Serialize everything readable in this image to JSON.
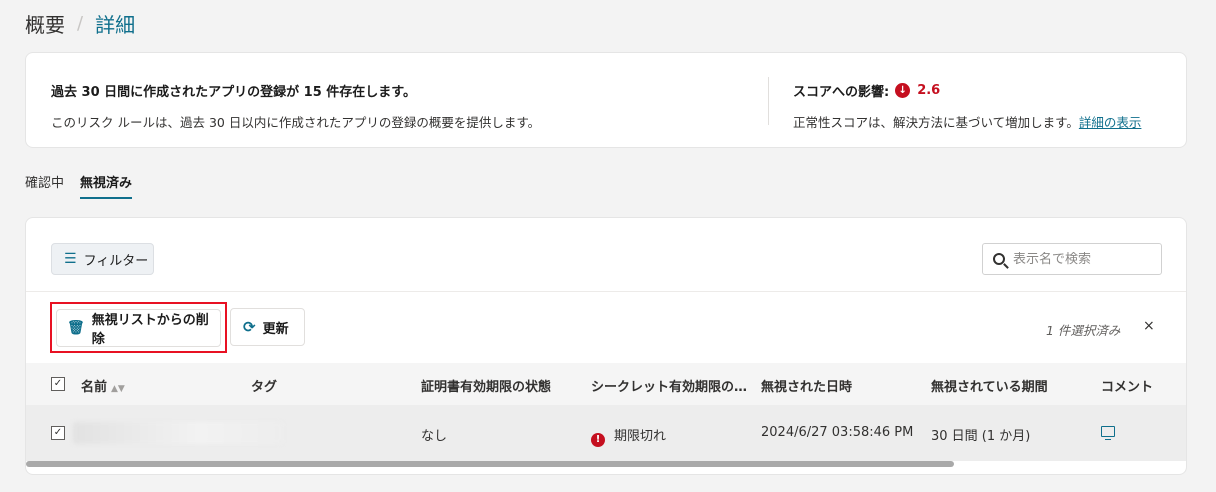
{
  "breadcrumb": {
    "parent": "概要",
    "separator": "/",
    "current": "詳細"
  },
  "summary": {
    "title": "過去 30 日間に作成されたアプリの登録が 15 件存在します。",
    "description": "このリスク ルールは、過去 30 日以内に作成されたアプリの登録の概要を提供します。",
    "impact_label": "スコアへの影響:",
    "impact_value": "2.6",
    "impact_direction": "down",
    "impact_color": "#c50f1f",
    "impact_desc": "正常性スコアは、解決方法に基づいて増加します。",
    "details_link": "詳細の表示"
  },
  "tabs": [
    {
      "label": "確認中",
      "active": false
    },
    {
      "label": "無視済み",
      "active": true
    }
  ],
  "toolbar": {
    "filter_label": "フィルター",
    "search_placeholder": "表示名で検索",
    "remove_label": "無視リストからの削除",
    "refresh_label": "更新",
    "selected_count": "1 件選択済み",
    "close_symbol": "×"
  },
  "table": {
    "columns": [
      "名前",
      "タグ",
      "証明書有効期限の状態",
      "シークレット有効期限の…",
      "無視された日時",
      "無視されている期間",
      "コメント"
    ],
    "rows": [
      {
        "checked": true,
        "name": "",
        "tag": "",
        "cert_status": "なし",
        "secret_status": "期限切れ",
        "ignored_at": "2024/6/27 03:58:46 PM",
        "ignored_period": "30 日間 (1 か月)"
      }
    ]
  },
  "colors": {
    "accent": "#0f6f8c",
    "error": "#c50f1f",
    "highlight": "#e81123"
  }
}
